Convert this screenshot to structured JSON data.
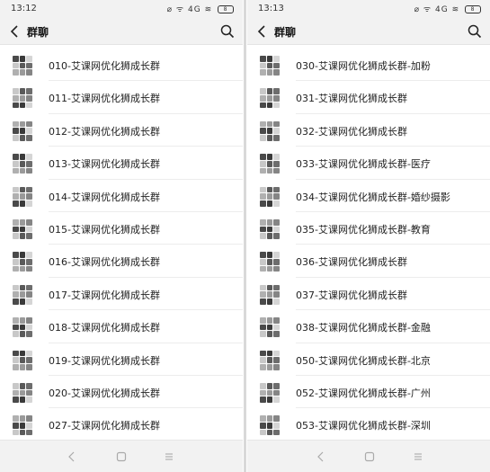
{
  "left": {
    "status": {
      "time": "13:12",
      "signal": "⌀ ᯤ 4G ≋",
      "battery": "8"
    },
    "header": {
      "title": "群聊"
    },
    "groups": [
      "010-艾课网优化狮成长群",
      "011-艾课网优化狮成长群",
      "012-艾课网优化狮成长群",
      "013-艾课网优化狮成长群",
      "014-艾课网优化狮成长群",
      "015-艾课网优化狮成长群",
      "016-艾课网优化狮成长群",
      "017-艾课网优化狮成长群",
      "018-艾课网优化狮成长群",
      "019-艾课网优化狮成长群",
      "020-艾课网优化狮成长群",
      "027-艾课网优化狮成长群"
    ]
  },
  "right": {
    "status": {
      "time": "13:13",
      "signal": "⌀ ᯤ 4G ≋",
      "battery": "8"
    },
    "header": {
      "title": "群聊"
    },
    "groups": [
      "030-艾课网优化狮成长群-加粉",
      "031-艾课网优化狮成长群",
      "032-艾课网优化狮成长群",
      "033-艾课网优化狮成长群-医疗",
      "034-艾课网优化狮成长群-婚纱摄影",
      "035-艾课网优化狮成长群-教育",
      "036-艾课网优化狮成长群",
      "037-艾课网优化狮成长群",
      "038-艾课网优化狮成长群-金融",
      "050-艾课网优化狮成长群-北京",
      "052-艾课网优化狮成长群-广州",
      "053-艾课网优化狮成长群-深圳"
    ]
  },
  "icons": {
    "back": "chevron-left-icon",
    "search": "search-icon",
    "nav_back": "nav-back-icon",
    "nav_home": "nav-home-icon",
    "nav_menu": "nav-menu-icon"
  }
}
